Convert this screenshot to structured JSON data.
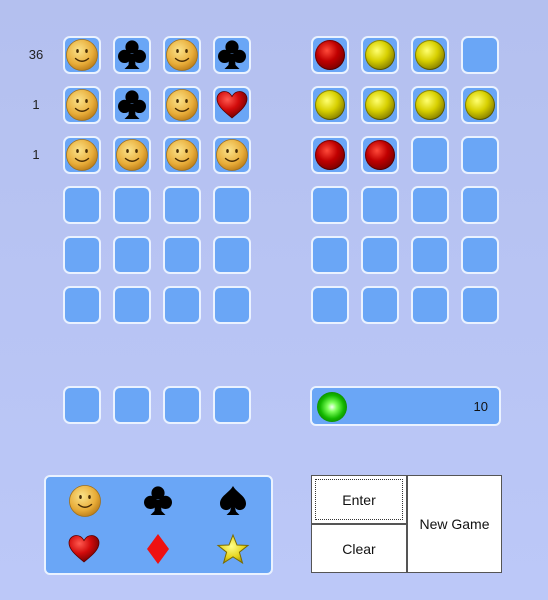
{
  "colors": {
    "cell": "#6aa6f6",
    "cell_border": "#eaf2ff",
    "background": "#b8c4f4"
  },
  "row_counts": [
    "36",
    "1",
    "1"
  ],
  "guess_rows": [
    [
      "smiley-icon",
      "club-icon",
      "smiley-icon",
      "club-icon"
    ],
    [
      "smiley-icon",
      "club-icon",
      "smiley-icon",
      "heart-icon"
    ],
    [
      "smiley-icon",
      "smiley-icon",
      "smiley-icon",
      "smiley-icon"
    ],
    [
      "",
      "",
      "",
      ""
    ],
    [
      "",
      "",
      "",
      ""
    ],
    [
      "",
      "",
      "",
      ""
    ]
  ],
  "feedback_rows": [
    [
      "red",
      "yellow",
      "yellow",
      ""
    ],
    [
      "yellow",
      "yellow",
      "yellow",
      "yellow"
    ],
    [
      "red",
      "red",
      "",
      ""
    ],
    [
      "",
      "",
      "",
      ""
    ],
    [
      "",
      "",
      "",
      ""
    ],
    [
      "",
      "",
      "",
      ""
    ]
  ],
  "current_guess": [
    "",
    "",
    "",
    ""
  ],
  "status": {
    "score": "10",
    "indicator": "green-orb"
  },
  "palette": [
    "smiley-icon",
    "club-icon",
    "spade-icon",
    "heart-icon",
    "diamond-icon",
    "star-icon"
  ],
  "buttons": {
    "enter": "Enter",
    "clear": "Clear",
    "new_game": "New Game"
  }
}
